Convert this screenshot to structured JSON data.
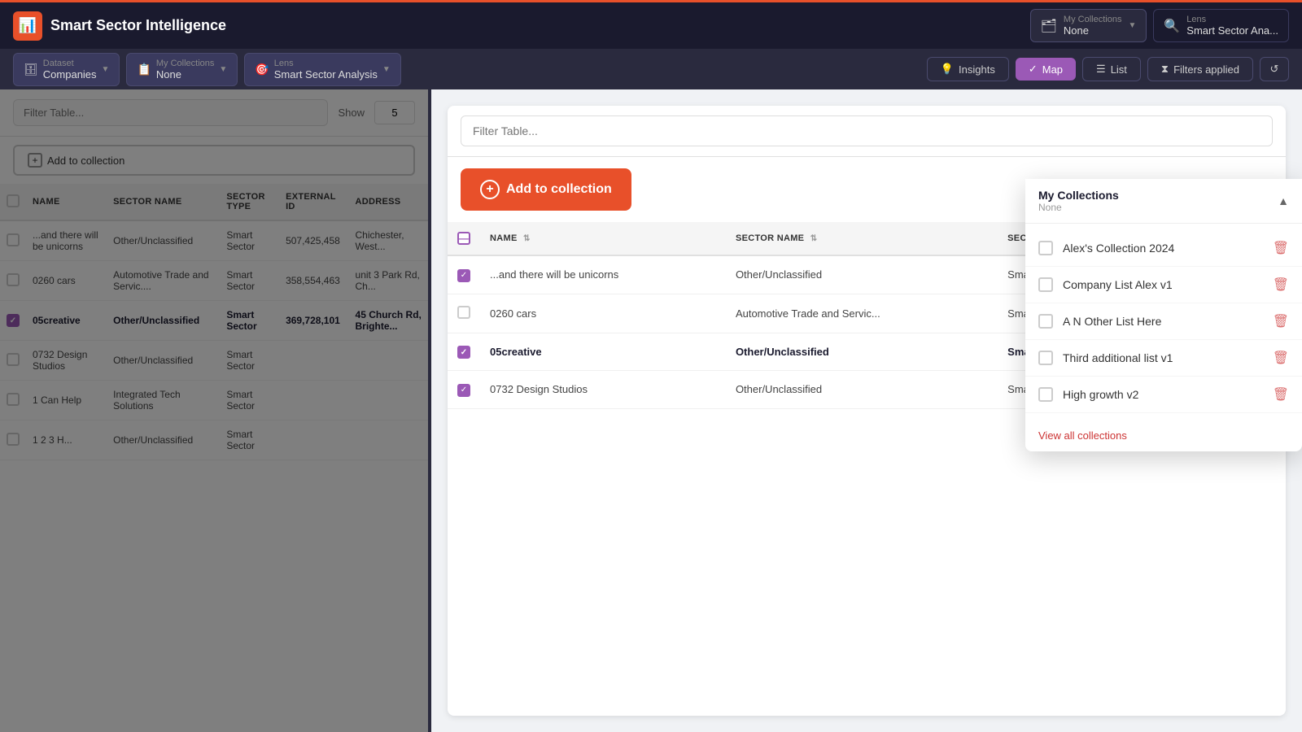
{
  "app": {
    "title": "Smart Sector Intelligence"
  },
  "topbar": {
    "logo_icon": "📊"
  },
  "subbar": {
    "dataset_label": "Dataset",
    "dataset_value": "Companies",
    "collections_label": "My Collections",
    "collections_value": "None",
    "lens_label": "Lens",
    "lens_value": "Smart Sector Analysis",
    "insights_btn": "Insights",
    "map_btn": "Map",
    "list_btn": "List",
    "filters_btn": "Filters applied",
    "reset_btn": "↺"
  },
  "left_table": {
    "filter_placeholder": "Filter Table...",
    "show_label": "Show",
    "show_count": "5",
    "add_collection_btn": "Add to collection",
    "columns": [
      "NAME",
      "SECTOR NAME",
      "SECTOR TYPE",
      "EXTERNAL ID",
      "ADDRESS"
    ],
    "rows": [
      {
        "checked": false,
        "name": "...and there will be unicorns",
        "sector_name": "Other/Unclassified",
        "sector_type": "Smart Sector",
        "external_id": "507,425,458",
        "address": "Chichester, West..."
      },
      {
        "checked": false,
        "name": "0260 cars",
        "sector_name": "Automotive Trade and Servic....",
        "sector_type": "Smart Sector",
        "external_id": "358,554,463",
        "address": "unit 3 Park Rd, Ch..."
      },
      {
        "checked": true,
        "name": "05creative",
        "sector_name": "Other/Unclassified",
        "sector_type": "Smart Sector",
        "external_id": "369,728,101",
        "address": "45 Church Rd, Brighte..."
      },
      {
        "checked": false,
        "name": "0732 Design Studios",
        "sector_name": "Other/Unclassified",
        "sector_type": "Smart Sector",
        "external_id": "",
        "address": ""
      },
      {
        "checked": false,
        "name": "1 Can Help",
        "sector_name": "Integrated Tech Solutions",
        "sector_type": "Smart Sector",
        "external_id": "",
        "address": ""
      },
      {
        "checked": false,
        "name": "1 2 3 H...",
        "sector_name": "Other/Unclassified",
        "sector_type": "Smart Sector",
        "external_id": "",
        "address": ""
      }
    ]
  },
  "right_panel": {
    "filter_placeholder": "Filter Table...",
    "add_collection_btn": "Add to collection",
    "columns": [
      "NAME",
      "SECTOR NAME",
      "SECTOR TYPE"
    ],
    "rows": [
      {
        "checked": true,
        "name": "...and there will be unicorns",
        "sector_name": "Other/Unclassified",
        "sector_type": "Smart Sector",
        "selected": false
      },
      {
        "checked": false,
        "name": "0260 cars",
        "sector_name": "Automotive Trade and Servic...",
        "sector_type": "Smart Sector",
        "selected": false
      },
      {
        "checked": true,
        "name": "05creative",
        "sector_name": "Other/Unclassified",
        "sector_type": "Smart Sector",
        "selected": true
      },
      {
        "checked": true,
        "name": "0732 Design Studios",
        "sector_name": "Other/Unclassified",
        "sector_type": "Smart Sector",
        "selected": false
      }
    ],
    "extra_column_header": "NAME",
    "extra_column_rows": [
      "Other/Unclassified"
    ]
  },
  "top_right_collections": {
    "title": "My Collections",
    "subtitle": "None",
    "items": [
      {
        "name": "Alex's Collection 2024",
        "checked": false
      },
      {
        "name": "Company List Alex v1",
        "checked": false
      },
      {
        "name": "A N Other List Here",
        "checked": false
      },
      {
        "name": "Third additional list v1",
        "checked": false
      },
      {
        "name": "High growth v2",
        "checked": false
      }
    ],
    "view_all": "View all collections"
  },
  "lens_nav": {
    "title": "Lens",
    "subtitle": "Smart Sector Ana..."
  },
  "colors": {
    "brand_dark": "#1a1a2e",
    "accent_red": "#e8502a",
    "accent_purple": "#9b59b6"
  }
}
